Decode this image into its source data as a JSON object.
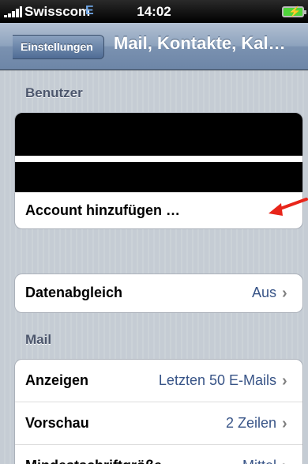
{
  "status_bar": {
    "carrier": "Swisscom",
    "network": "E",
    "time": "14:02",
    "signal_icon": "signal-bars-icon",
    "battery_icon": "battery-charging-icon"
  },
  "nav_bar": {
    "back_label": "Einstellungen",
    "title": "Mail, Kontakte, Kal…"
  },
  "sections": {
    "users_header": "Benutzer",
    "mail_header": "Mail"
  },
  "accounts": {
    "add_account_label": "Account hinzufügen …"
  },
  "sync": {
    "label": "Datenabgleich",
    "value": "Aus"
  },
  "mail_settings": [
    {
      "label": "Anzeigen",
      "value": "Letzten 50 E-Mails"
    },
    {
      "label": "Vorschau",
      "value": "2 Zeilen"
    },
    {
      "label": "Mindestschriftgröße",
      "value": "Mittel"
    }
  ],
  "colors": {
    "background": "#c5ccd4",
    "value_text": "#385487",
    "annotation_arrow": "#e8251a"
  }
}
